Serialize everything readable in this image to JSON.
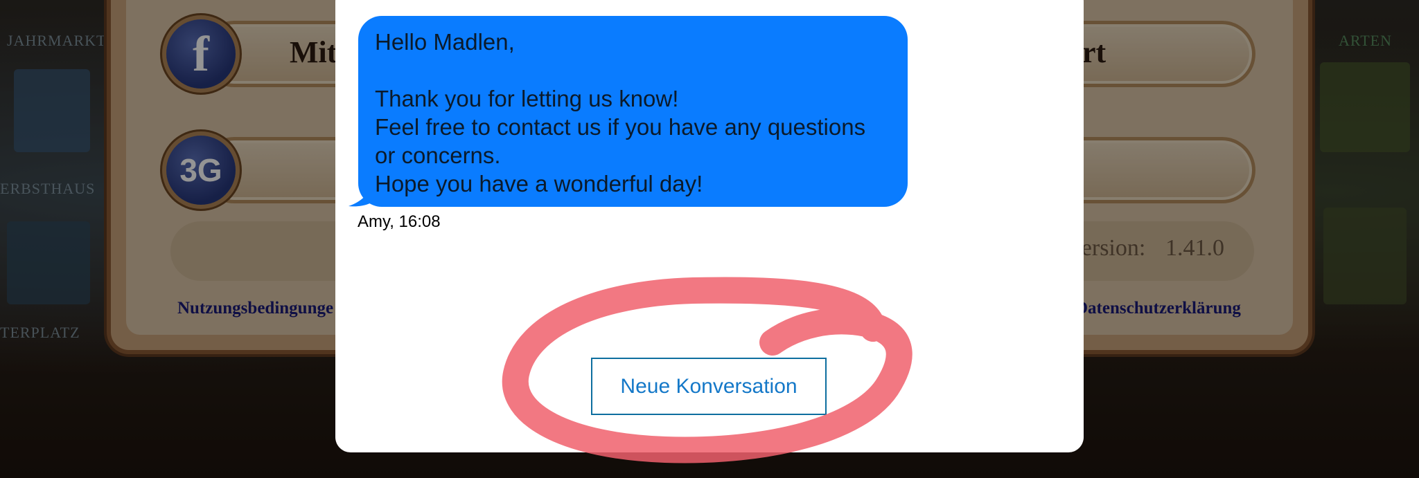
{
  "background": {
    "labels": [
      "JAHRMARKT",
      "ERBSTHAUS",
      "TERPLATZ",
      "ARTEN"
    ]
  },
  "settings_panel": {
    "facebook_icon": "f",
    "facebook_label_left": "Mit",
    "facebook_label_right": "ort",
    "network_icon": "3G",
    "version_label": "Version:",
    "version_value": "1.41.0",
    "terms_link": "Nutzungsbedingunge",
    "privacy_link": "Datenschutzerklärung"
  },
  "chat": {
    "message_text": "Hello Madlen,\n\nThank you for letting us know!\nFeel free to contact us if you have any questions\nor concerns.\nHope you have a wonderful day!",
    "meta": "Amy, 16:08",
    "new_conversation_label": "Neue Konversation",
    "bubble_color": "#0a7cff",
    "annotation_color": "#f0606c"
  }
}
